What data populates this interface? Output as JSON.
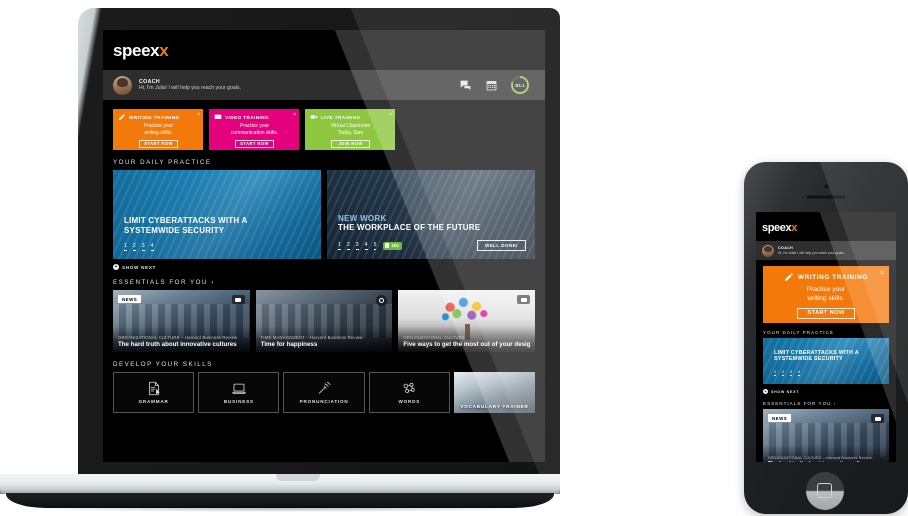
{
  "app": {
    "logo_text": "speex",
    "logo_accent": "x",
    "accent_color": "#f07c12"
  },
  "coach": {
    "name": "COACH",
    "message": "Hi, I'm Julia! I will help you reach your goals.",
    "chat_icon": "chat-bubbles-icon",
    "calendar_icon": "calendar-icon",
    "level": "B1.1",
    "level_ring_color": "#8dc63f"
  },
  "promos": [
    {
      "title": "WRITING TRAINING",
      "subtitle": "Practice your\nwriting skills.",
      "subtitle_line1": "Practice your",
      "subtitle_line2": "writing skills.",
      "button": "START NOW",
      "color": "#f4790b",
      "icon": "pencil-icon",
      "close": "×"
    },
    {
      "title": "VIDEO TRAINING",
      "subtitle_line1": "Practice your",
      "subtitle_line2": "communication skills.",
      "button": "START NOW",
      "color": "#e5007e",
      "icon": "video-chat-icon",
      "close": "×"
    },
    {
      "title": "LIVE TRAINING",
      "subtitle_line1": "Virtual Classroom",
      "subtitle_line2": "Today, 9am",
      "button": "JOIN NOW",
      "color": "#8dc63f",
      "icon": "video-camera-icon",
      "close": "×"
    }
  ],
  "daily_practice": {
    "section_title": "YOUR DAILY PRACTICE",
    "cards": [
      {
        "kicker": "",
        "title_line1": "LIMIT CYBERATTACKS WITH A",
        "title_line2": "SYSTEMWIDE SECURITY",
        "steps": [
          "1",
          "2",
          "3",
          "4"
        ]
      },
      {
        "kicker": "NEW WORK",
        "title_line1": "THE WORKPLACE OF THE FUTURE",
        "title_line2": "",
        "steps": [
          "1",
          "2",
          "3",
          "4",
          "5"
        ],
        "score": "100",
        "done_button": "WELL DONE!"
      }
    ],
    "show_next": "SHOW NEXT",
    "show_next_icon": "plus-circle-icon"
  },
  "essentials": {
    "section_title": "ESSENTIALS FOR YOU",
    "chevron": "›",
    "cards": [
      {
        "badge": "NEWS",
        "media_icon": "video-play-icon",
        "source": "ORGANIZATIONAL CULTURE – Harvard Business Review",
        "title": "The hard truth about innovative cultures"
      },
      {
        "badge": "",
        "media_icon": "camera-icon",
        "source": "TIME MANAGEMENT – Harvard Business Review",
        "title": "Time for happiness"
      },
      {
        "badge": "",
        "media_icon": "video-play-icon",
        "source": "ORGANIZATIONAL CULTURE",
        "title": "Five ways to get the most out of your design ..."
      }
    ]
  },
  "skills": {
    "section_title": "DEVELOP YOUR SKILLS",
    "tiles": [
      {
        "label": "GRAMMAR",
        "icon": "document-pencil-icon"
      },
      {
        "label": "BUSINESS",
        "icon": "laptop-icon"
      },
      {
        "label": "PRONUNCIATION",
        "icon": "tuning-fork-icon"
      },
      {
        "label": "WORDS",
        "icon": "word-network-icon"
      },
      {
        "label": "VOCABULARY TRAINER",
        "icon": "tablet-photo-icon"
      }
    ]
  }
}
